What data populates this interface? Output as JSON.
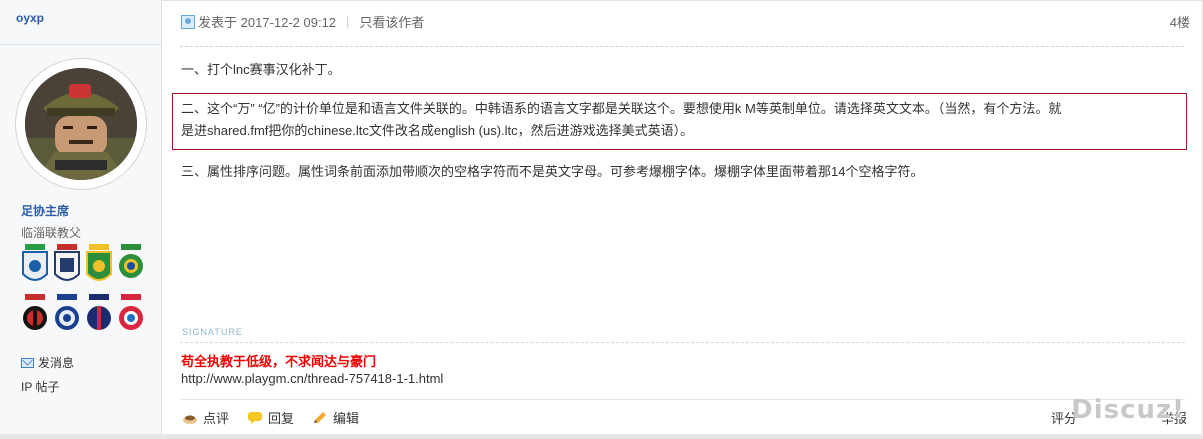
{
  "sidebar": {
    "username": "oyxp",
    "group_title": "足协主席",
    "group_sub": "临淄联教父",
    "send_message": "发消息",
    "ip_posts": "IP 帖子"
  },
  "post": {
    "posted_at": "发表于 2017-12-2 09:12",
    "separator": "|",
    "only_author": "只看该作者",
    "floor": "4楼",
    "para1": "一、打个lnc赛事汉化补丁。",
    "para2_line1": "二、这个“万” “亿”的计价单位是和语言文件关联的。中韩语系的语言文字都是关联这个。要想使用k M等英制单位。请选择英文文本。（当然，有个方法。就",
    "para2_line2": "是进shared.fmf把你的chinese.ltc文件改名成english (us).ltc，然后进游戏选择美式英语）。",
    "para3": "三、属性排序问题。属性词条前面添加带顺次的空格字符而不是英文字母。可参考爆棚字体。爆棚字体里面带着那14个空格字符。"
  },
  "signature": {
    "label": "SIGNATURE",
    "red_line": "苟全执教于低级，不求闻达与豪门",
    "url": "http://www.playgm.cn/thread-757418-1-1.html"
  },
  "footer": {
    "comment": "点评",
    "reply": "回复",
    "edit": "编辑",
    "rate": "评分",
    "report": "举报"
  },
  "watermark": "Discuz!",
  "colors": {
    "link_blue": "#2a5caa",
    "highlight_border": "#9e1b2a",
    "signature_red": "#ee0000"
  }
}
